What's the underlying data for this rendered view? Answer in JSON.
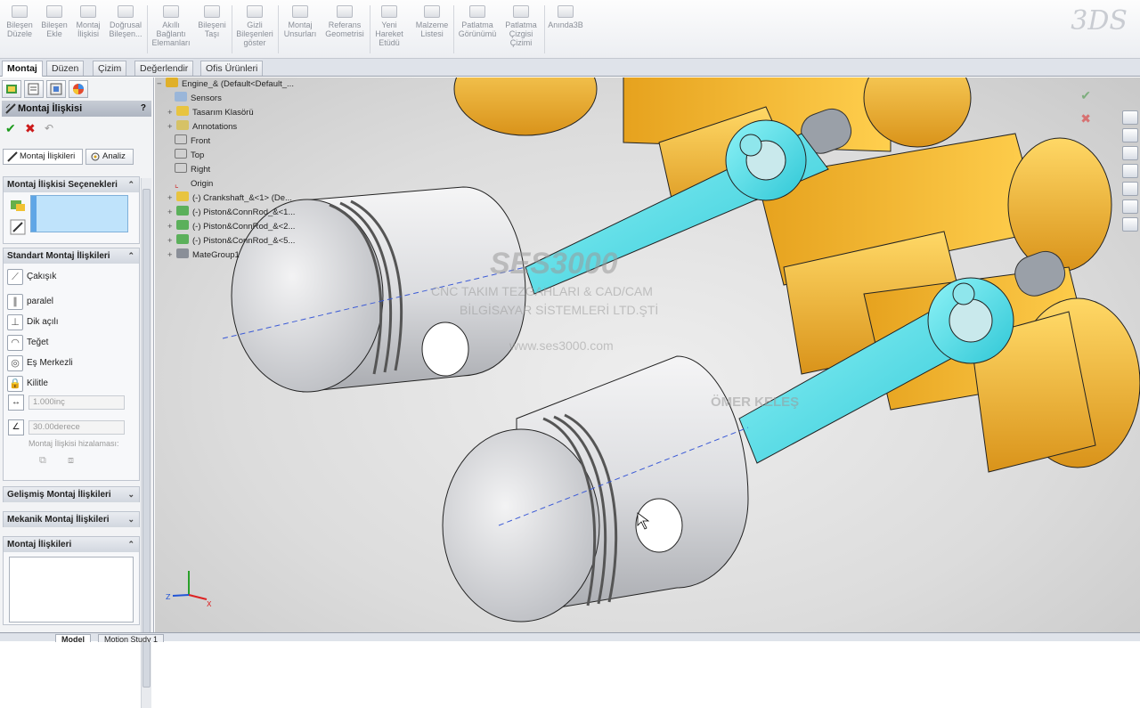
{
  "ribbon": {
    "buttons": [
      {
        "label": "Bileşen\nDüzele"
      },
      {
        "label": "Bileşen\nEkle"
      },
      {
        "label": "Montaj\nİlişkisi"
      },
      {
        "label": "Doğrusal\nBileşen..."
      },
      {
        "label": "Akıllı\nBağlantı\nElemanları"
      },
      {
        "label": "Bileşeni\nTaşı"
      },
      {
        "label": "Gizli\nBileşenleri\ngöster"
      },
      {
        "label": "Montaj\nUnsurları"
      },
      {
        "label": "Referans\nGeometrisi"
      },
      {
        "label": "Yeni\nHareket\nEtüdü"
      },
      {
        "label": "Malzeme\nListesi"
      },
      {
        "label": "Patlatma\nGörünümü"
      },
      {
        "label": "Patlatma\nÇizgisi\nÇizimi"
      },
      {
        "label": "Anında3B"
      }
    ]
  },
  "command_tabs": [
    "Montaj",
    "Düzen",
    "Çizim",
    "Değerlendir",
    "Ofis Ürünleri"
  ],
  "property_manager": {
    "title": "Montaj İlişkisi",
    "help": "?",
    "subtabs": [
      "Montaj İlişkileri",
      "Analiz"
    ],
    "selections_header": "Montaj İlişkisi Seçenekleri",
    "standard_header": "Standart Montaj İlişkileri",
    "standard_mates": [
      "Çakışık",
      "paralel",
      "Dik açılı",
      "Teğet",
      "Eş Merkezli",
      "Kilitle"
    ],
    "distance_value": "1.000inç",
    "angle_value": "30.00derece",
    "alignment_label": "Montaj İlişkisi hizalaması:",
    "advanced_header": "Gelişmiş Montaj İlişkileri",
    "mechanical_header": "Mekanik Montaj İlişkileri",
    "mates_header": "Montaj İlişkileri"
  },
  "feature_tree": {
    "root": "Engine_& (Default<Default_...",
    "items": [
      "Sensors",
      "Tasarım Klasörü",
      "Annotations",
      "Front",
      "Top",
      "Right",
      "Origin",
      "(-) Crankshaft_&<1> (De...",
      "(-) Piston&ConnRod_&<1...",
      "(-) Piston&ConnRod_&<2...",
      "(-) Piston&ConnRod_&<5...",
      "MateGroup1"
    ]
  },
  "watermark": {
    "brand": "SES3000",
    "line1": "CNC TAKIM TEZGAHLARI & CAD/CAM",
    "line2": "BİLGİSAYAR SİSTEMLERİ LTD.ŞTİ",
    "web": "www.ses3000.com",
    "author": "ÖMER KELEŞ"
  },
  "bottom_tabs": [
    "Model",
    "Motion Study 1"
  ],
  "colors": {
    "crank_yellow": "#f3b83a",
    "rod_cyan": "#5fe6ef",
    "piston_grey": "#d9dadc",
    "accent_blue": "#1f5fb4"
  }
}
